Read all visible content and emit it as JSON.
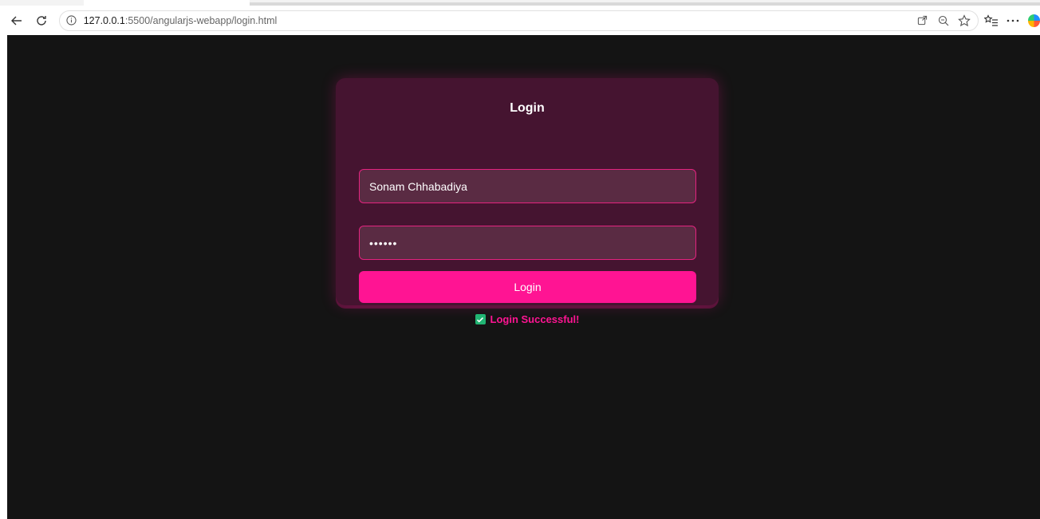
{
  "browser": {
    "url_host": "127.0.0.1",
    "url_path": ":5500/angularjs-webapp/login.html",
    "icons": [
      "back-arrow-icon",
      "refresh-icon",
      "info-icon",
      "open-in-app-icon",
      "zoom-icon",
      "favorite-star-icon",
      "favorites-list-icon",
      "more-icon",
      "copilot-icon"
    ]
  },
  "login": {
    "title": "Login",
    "username_value": "Sonam Chhabadiya",
    "password_value": "••••••",
    "button_label": "Login",
    "status_message": "Login Successful!"
  },
  "colors": {
    "page_background": "#141414",
    "card_background": "#451430",
    "accent": "#ff1493",
    "field_background": "#5a2b43",
    "success_check": "#21b573"
  }
}
